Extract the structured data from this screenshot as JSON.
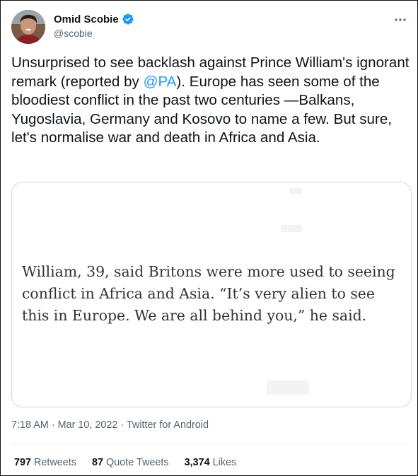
{
  "author": {
    "display_name": "Omid Scobie",
    "handle": "@scobie",
    "verified": true,
    "avatar_icon": "user-avatar"
  },
  "tweet": {
    "text_before_mention": "Unsurprised to see backlash against Prince William's ignorant remark (reported by ",
    "mention": "@PA",
    "text_after_mention": "). Europe has seen some of the bloodiest conflict in the past two centuries —Balkans, Yugoslavia, Germany and Kosovo to name a few. But sure, let's normalise war and death in Africa and Asia."
  },
  "media": {
    "quote_text": "William, 39, said Britons were more used to seeing conflict in Africa and Asia. “It’s very alien to see this in Europe. We are all behind you,” he said."
  },
  "meta": {
    "time": "7:18 AM",
    "separator": "·",
    "date": "Mar 10, 2022",
    "source": "Twitter for Android"
  },
  "stats": {
    "retweets_count": "797",
    "retweets_label": "Retweets",
    "quote_tweets_count": "87",
    "quote_tweets_label": "Quote Tweets",
    "likes_count": "3,374",
    "likes_label": "Likes"
  },
  "colors": {
    "accent": "#1d9bf0",
    "text_primary": "#0f1419",
    "text_secondary": "#536471",
    "border": "#cfd9de"
  }
}
